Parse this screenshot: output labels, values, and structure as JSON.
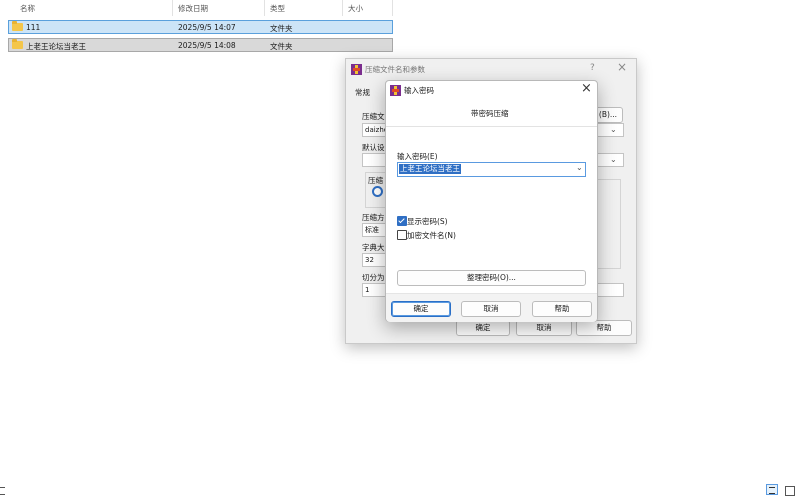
{
  "explorer": {
    "columns": [
      "名称",
      "修改日期",
      "类型",
      "大小"
    ],
    "rows": [
      {
        "name": "111",
        "date": "2025/9/5 14:07",
        "type": "文件夹"
      },
      {
        "name": "上老王论坛当老王",
        "date": "2025/9/5 14:08",
        "type": "文件夹"
      }
    ]
  },
  "archive_dialog": {
    "title": "压缩文件名和参数",
    "help_icon": "?",
    "close_icon": "×",
    "tab_general": "常规",
    "archive_name_label": "压缩文",
    "archive_name_value": "daizhe",
    "browse_button": "(B)...",
    "default_label": "默认设",
    "format_label": "压缩",
    "method_label": "压缩方",
    "method_value": "标准",
    "dict_label": "字典大",
    "dict_value": "32",
    "split_label": "切分为",
    "split_value": "1",
    "ok_button": "确定",
    "cancel_button": "取消",
    "help_button": "帮助"
  },
  "password_dialog": {
    "title": "输入密码",
    "close_icon": "×",
    "heading": "带密码压缩",
    "password_label": "输入密码(E)",
    "password_value": "上老王论坛当老王",
    "show_password_label": "显示密码(S)",
    "show_password_checked": true,
    "encrypt_names_label": "加密文件名(N)",
    "encrypt_names_checked": false,
    "organize_button": "整理密码(O)...",
    "ok_button": "确定",
    "cancel_button": "取消",
    "help_button": "帮助"
  },
  "colors": {
    "selection": "#cce4f7",
    "accent": "#2f6fc4",
    "folder": "#f4c64a"
  }
}
